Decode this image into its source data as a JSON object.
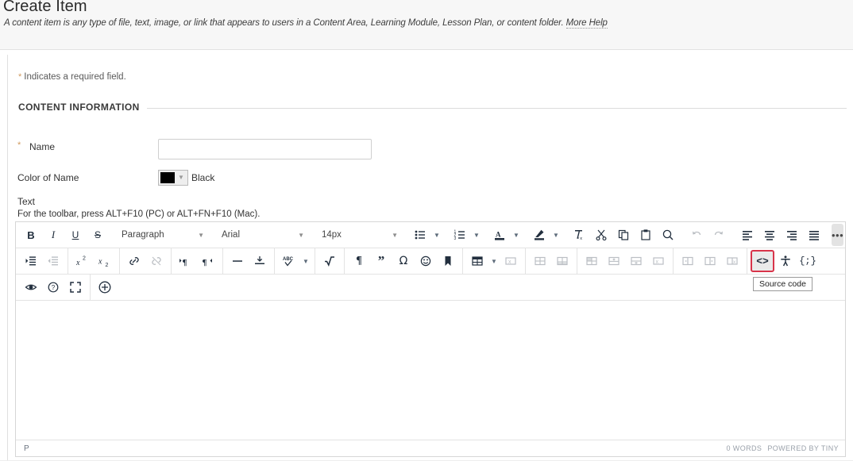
{
  "page": {
    "title": "Create Item",
    "description": "A content item is any type of file, text, image, or link that appears to users in a Content Area, Learning Module, Lesson Plan, or content folder.",
    "more_help": "More Help",
    "required_note": "Indicates a required field.",
    "required_star": "*"
  },
  "section": {
    "heading": "CONTENT INFORMATION"
  },
  "form": {
    "name_label": "Name",
    "name_value": "",
    "name_placeholder": "",
    "color_label": "Color of Name",
    "color_value": "Black",
    "color_hex": "#000000",
    "text_label": "Text",
    "text_hint": "For the toolbar, press ALT+F10 (PC) or ALT+FN+F10 (Mac)."
  },
  "editor": {
    "row1": {
      "bold": "B",
      "italic": "I",
      "underline": "U",
      "strikethrough": "S",
      "paragraph_format": "Paragraph",
      "font_family": "Arial",
      "font_size": "14px",
      "bullet_list": "bullist",
      "numbered_list": "numlist",
      "text_color": "A",
      "background_color": "highlight",
      "clear_formatting": "removeformat",
      "cut": "cut",
      "copy": "copy",
      "paste": "paste",
      "search_replace": "searchreplace",
      "undo": "undo",
      "redo": "redo",
      "align_left": "alignleft",
      "align_center": "aligncenter",
      "align_right": "alignright",
      "align_justify": "alignjustify",
      "more": "•••"
    },
    "row2": {
      "indent": "indent",
      "outdent": "outdent",
      "superscript": "x2",
      "subscript": "x2",
      "link": "link",
      "unlink": "unlink",
      "ltr": "ltr",
      "rtl": "rtl",
      "horizontal_rule": "hr",
      "page_break": "pagebreak",
      "spellcheck": "spellcheck",
      "math": "math",
      "paragraph_mark": "¶",
      "blockquote": "”",
      "special_character": "Ω",
      "emoticon": "emoticon",
      "anchor": "anchor",
      "table": "table",
      "delete_table": "deletetable",
      "table_row_props": "rowprops",
      "table_cell_props": "cellprops",
      "insert_row_before": "rowbefore",
      "insert_row_after": "rowafter",
      "delete_row": "deleterow",
      "merge_cells": "mergecells",
      "insert_col_before": "colbefore",
      "insert_col_after": "colafter",
      "delete_col": "deletecol",
      "source_code": "<>",
      "accessibility": "a11y",
      "embed": "{;}"
    },
    "row3": {
      "preview": "preview",
      "help": "help",
      "fullscreen": "fullscreen",
      "insert": "plus"
    },
    "content": "",
    "status_path": "P",
    "word_count": "0 WORDS",
    "branding": "POWERED BY TINY"
  },
  "tooltip": {
    "label": "Source code"
  },
  "colors": {
    "accent_required": "#d09a5f",
    "highlight_border": "#d8344a",
    "header_bg": "#f7f7f7",
    "toolbar_icon": "#222f3e"
  }
}
